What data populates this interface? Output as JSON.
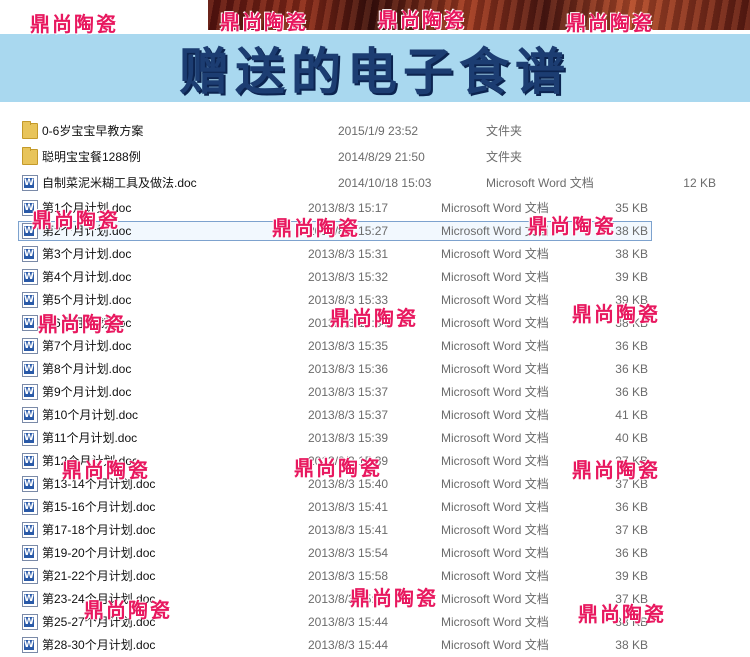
{
  "banner": {
    "title": "赠送的电子食谱"
  },
  "watermark_text": "鼎尚陶瓷",
  "colors": {
    "banner_bg": "#a9d8ef",
    "banner_text": "#1c3d72",
    "watermark": "#e8185f",
    "selection_border": "#7da2ce"
  },
  "files": [
    {
      "icon": "folder-icon",
      "name": "0-6岁宝宝早教方案",
      "date": "2015/1/9 23:52",
      "type": "文件夹",
      "size": ""
    },
    {
      "icon": "folder-icon",
      "name": "聪明宝宝餐1288例",
      "date": "2014/8/29 21:50",
      "type": "文件夹",
      "size": ""
    },
    {
      "icon": "word-doc-icon",
      "name": "自制菜泥米糊工具及做法.doc",
      "date": "2014/10/18 15:03",
      "type": "Microsoft Word 文档",
      "size": "12 KB"
    },
    {
      "icon": "word-doc-icon",
      "name": "第1个月计划.doc",
      "date": "2013/8/3 15:17",
      "type": "Microsoft Word 文档",
      "size": "35 KB"
    },
    {
      "icon": "word-doc-icon",
      "name": "第2个月计划.doc",
      "date": "2013/8/3 15:27",
      "type": "Microsoft Word 文档",
      "size": "38 KB",
      "selected": true
    },
    {
      "icon": "word-doc-icon",
      "name": "第3个月计划.doc",
      "date": "2013/8/3 15:31",
      "type": "Microsoft Word 文档",
      "size": "38 KB"
    },
    {
      "icon": "word-doc-icon",
      "name": "第4个月计划.doc",
      "date": "2013/8/3 15:32",
      "type": "Microsoft Word 文档",
      "size": "39 KB"
    },
    {
      "icon": "word-doc-icon",
      "name": "第5个月计划.doc",
      "date": "2013/8/3 15:33",
      "type": "Microsoft Word 文档",
      "size": "39 KB"
    },
    {
      "icon": "word-doc-icon",
      "name": "第6个月计划.doc",
      "date": "2013/8/3 15:34",
      "type": "Microsoft Word 文档",
      "size": "38 KB"
    },
    {
      "icon": "word-doc-icon",
      "name": "第7个月计划.doc",
      "date": "2013/8/3 15:35",
      "type": "Microsoft Word 文档",
      "size": "36 KB"
    },
    {
      "icon": "word-doc-icon",
      "name": "第8个月计划.doc",
      "date": "2013/8/3 15:36",
      "type": "Microsoft Word 文档",
      "size": "36 KB"
    },
    {
      "icon": "word-doc-icon",
      "name": "第9个月计划.doc",
      "date": "2013/8/3 15:37",
      "type": "Microsoft Word 文档",
      "size": "36 KB"
    },
    {
      "icon": "word-doc-icon",
      "name": "第10个月计划.doc",
      "date": "2013/8/3 15:37",
      "type": "Microsoft Word 文档",
      "size": "41 KB"
    },
    {
      "icon": "word-doc-icon",
      "name": "第11个月计划.doc",
      "date": "2013/8/3 15:39",
      "type": "Microsoft Word 文档",
      "size": "40 KB"
    },
    {
      "icon": "word-doc-icon",
      "name": "第12个月计划.doc",
      "date": "2013/8/3 15:39",
      "type": "Microsoft Word 文档",
      "size": "37 KB"
    },
    {
      "icon": "word-doc-icon",
      "name": "第13-14个月计划.doc",
      "date": "2013/8/3 15:40",
      "type": "Microsoft Word 文档",
      "size": "37 KB"
    },
    {
      "icon": "word-doc-icon",
      "name": "第15-16个月计划.doc",
      "date": "2013/8/3 15:41",
      "type": "Microsoft Word 文档",
      "size": "36 KB"
    },
    {
      "icon": "word-doc-icon",
      "name": "第17-18个月计划.doc",
      "date": "2013/8/3 15:41",
      "type": "Microsoft Word 文档",
      "size": "37 KB"
    },
    {
      "icon": "word-doc-icon",
      "name": "第19-20个月计划.doc",
      "date": "2013/8/3 15:54",
      "type": "Microsoft Word 文档",
      "size": "36 KB"
    },
    {
      "icon": "word-doc-icon",
      "name": "第21-22个月计划.doc",
      "date": "2013/8/3 15:58",
      "type": "Microsoft Word 文档",
      "size": "39 KB"
    },
    {
      "icon": "word-doc-icon",
      "name": "第23-24个月计划.doc",
      "date": "2013/8/3 15:43",
      "type": "Microsoft Word 文档",
      "size": "37 KB"
    },
    {
      "icon": "word-doc-icon",
      "name": "第25-27个月计划.doc",
      "date": "2013/8/3 15:44",
      "type": "Microsoft Word 文档",
      "size": "38 KB"
    },
    {
      "icon": "word-doc-icon",
      "name": "第28-30个月计划.doc",
      "date": "2013/8/3 15:44",
      "type": "Microsoft Word 文档",
      "size": "38 KB"
    }
  ]
}
